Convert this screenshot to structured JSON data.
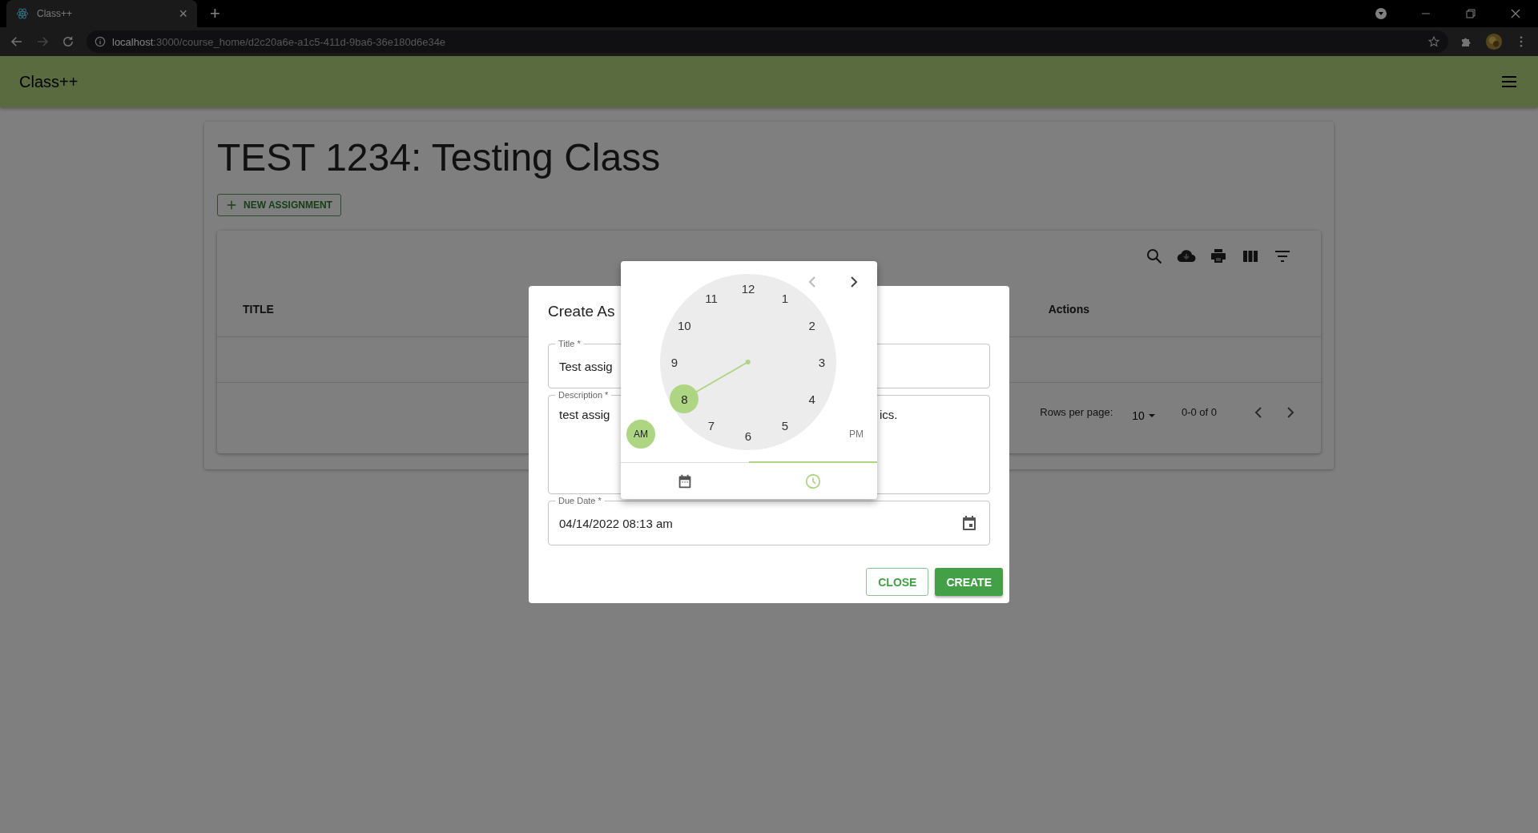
{
  "browser": {
    "tab_title": "Class++",
    "tab_close": "×",
    "new_tab": "+",
    "url_host": "localhost",
    "url_path": ":3000/course_home/d2c20a6e-a1c5-411d-9ba6-36e180d6e34e"
  },
  "app_bar": {
    "title": "Class++"
  },
  "page": {
    "heading": "TEST 1234: Testing Class",
    "new_button": "NEW ASSIGNMENT"
  },
  "table": {
    "columns": [
      "TITLE",
      "Actions"
    ],
    "rows_per_page_label": "Rows per page:",
    "rows_per_page": "10",
    "range": "0-0 of 0"
  },
  "dialog": {
    "title": "Create As",
    "fields": [
      {
        "kind": "text",
        "label": "Title *",
        "value": "Test assig"
      },
      {
        "kind": "multiline",
        "label": "Description *",
        "value": "test assig",
        "value_right": "ics."
      },
      {
        "kind": "date",
        "label": "Due Date *",
        "value": "04/14/2022 08:13 am"
      }
    ],
    "buttons": [
      {
        "kind": "outlined",
        "label": "CLOSE"
      },
      {
        "kind": "contained",
        "label": "CREATE"
      }
    ]
  },
  "clock_picker": {
    "nav": [
      {
        "kind": "prev",
        "disabled": true
      },
      {
        "kind": "next",
        "disabled": false
      }
    ],
    "hours": [
      {
        "label": "12",
        "selected": false
      },
      {
        "label": "1",
        "selected": false
      },
      {
        "label": "2",
        "selected": false
      },
      {
        "label": "3",
        "selected": false
      },
      {
        "label": "4",
        "selected": false
      },
      {
        "label": "5",
        "selected": false
      },
      {
        "label": "6",
        "selected": false
      },
      {
        "label": "7",
        "selected": false
      },
      {
        "label": "8",
        "selected": true
      },
      {
        "label": "9",
        "selected": false
      },
      {
        "label": "10",
        "selected": false
      },
      {
        "label": "11",
        "selected": false
      }
    ],
    "meridiem": [
      {
        "label": "AM",
        "selected": true
      },
      {
        "label": "PM",
        "selected": false
      }
    ],
    "tabs": [
      {
        "kind": "date",
        "selected": false
      },
      {
        "kind": "time",
        "selected": true
      }
    ]
  }
}
